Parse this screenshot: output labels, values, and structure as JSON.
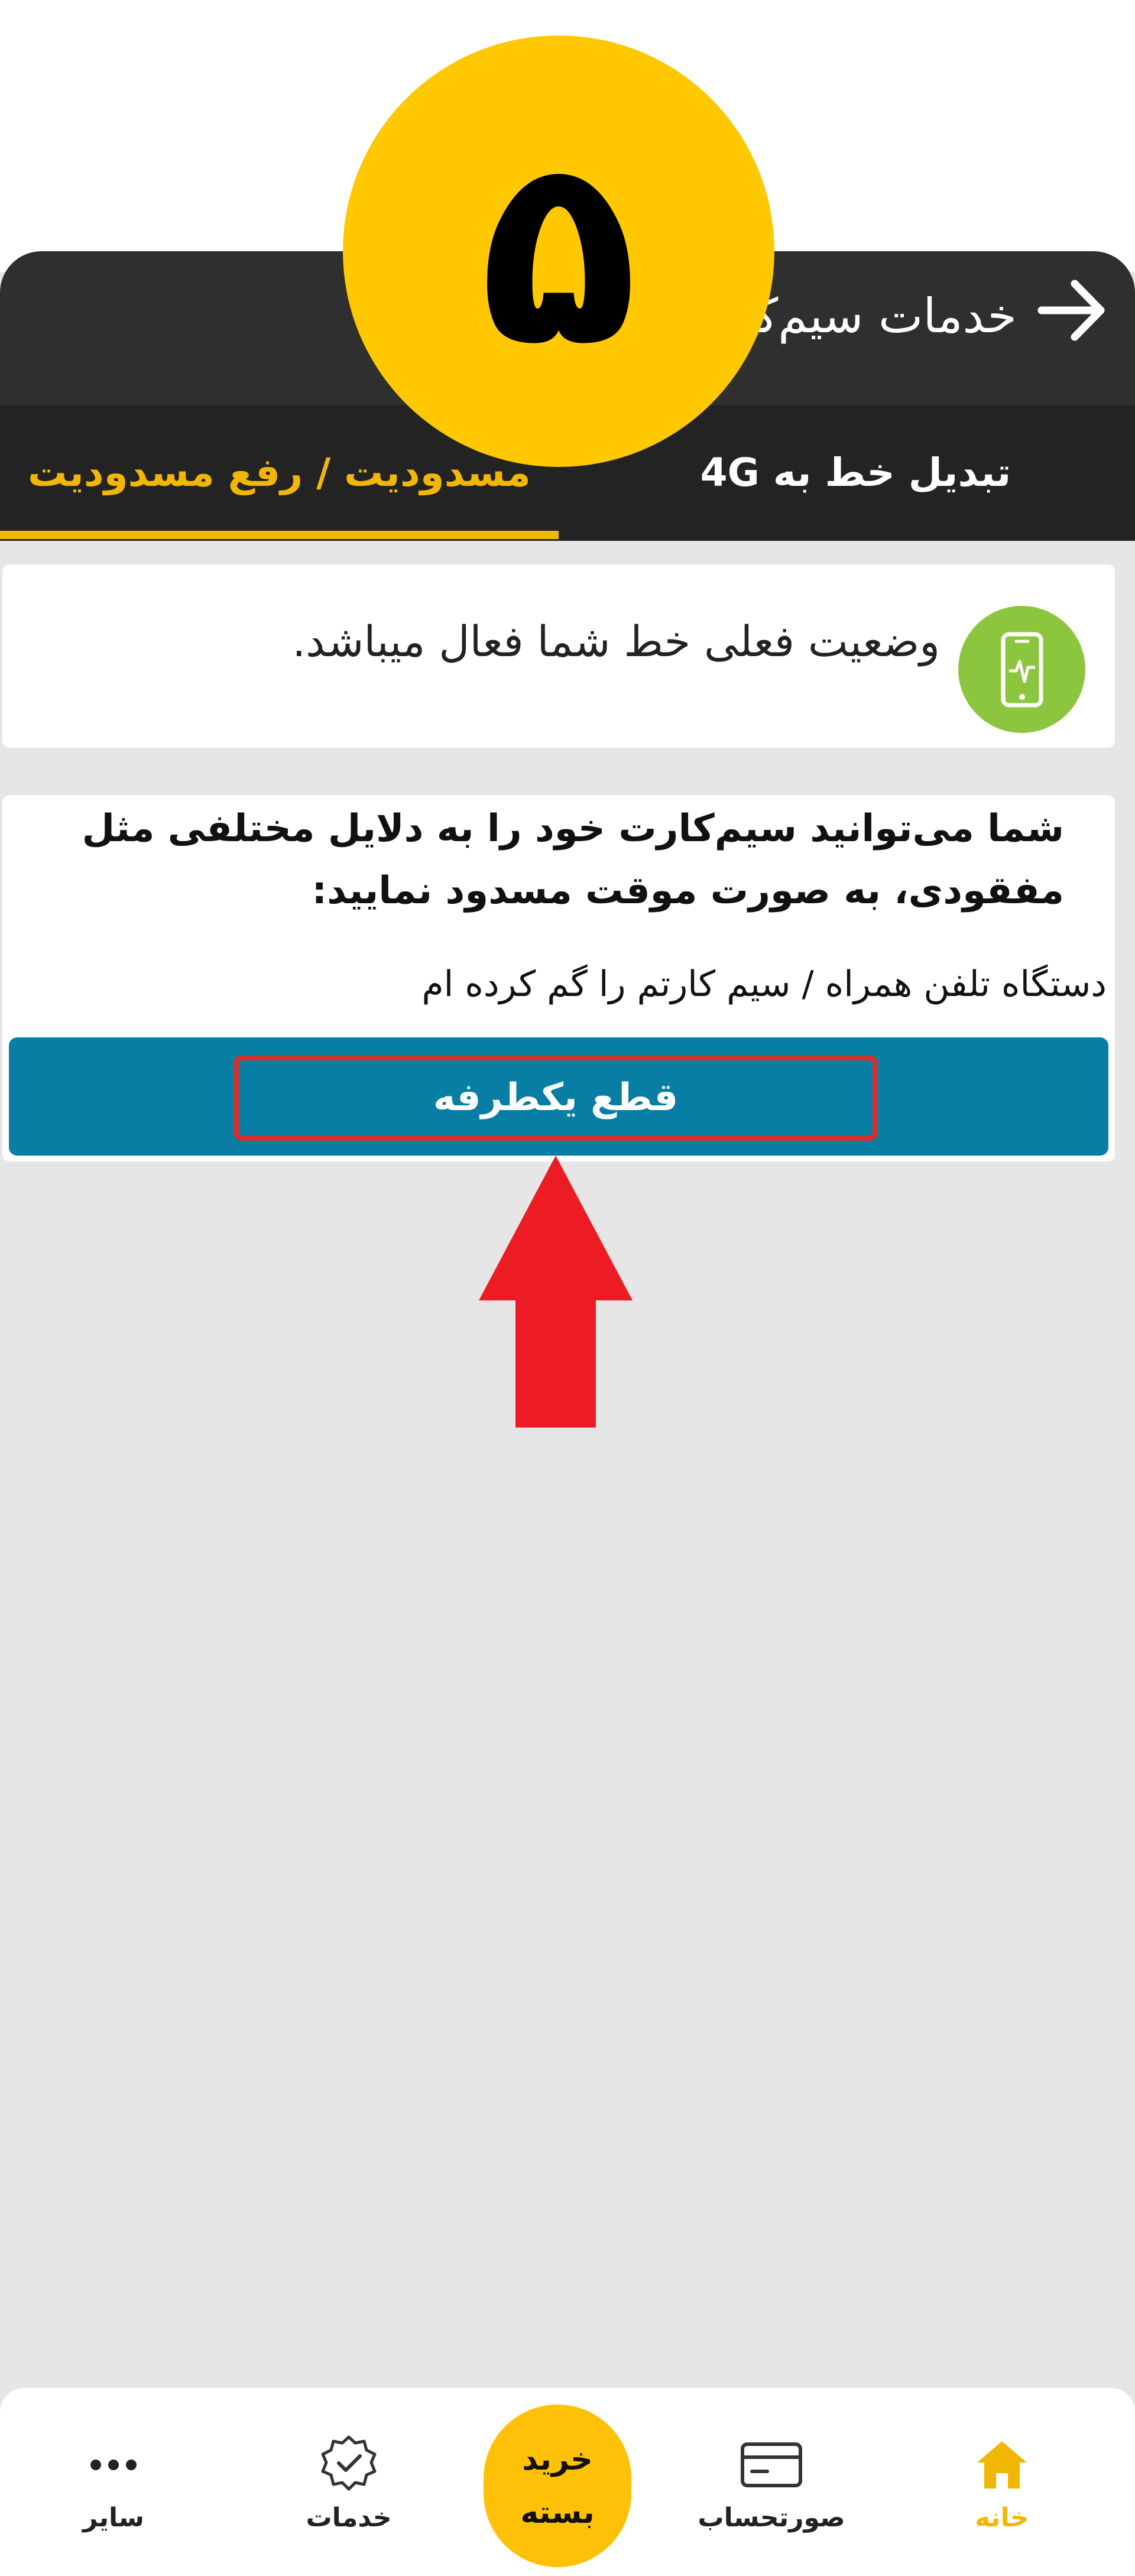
{
  "step": {
    "number": "۵"
  },
  "header": {
    "title": "خدمات سیم‌کارت",
    "back_icon": "arrow-right-icon"
  },
  "tabs": [
    {
      "label": "تبدیل خط به 4G",
      "active": false
    },
    {
      "label": "مسدودیت / رفع مسدودیت",
      "active": true
    }
  ],
  "status": {
    "icon": "phone-signal-icon",
    "text": "وضعیت فعلی خط شما فعال میباشد."
  },
  "block": {
    "description": "شما می‌توانید سیم‌کارت خود را به دلایل مختلفی مثل مفقودی، به صورت موقت مسدود نمایید:",
    "reason": "دستگاه تلفن همراه / سیم کارتم را گم کرده ام",
    "action_label": "قطع یکطرفه"
  },
  "nav": {
    "home": "خانه",
    "bill": "صورتحساب",
    "buy": "خرید بسته",
    "services": "خدمات",
    "other": "سایر"
  },
  "colors": {
    "accent": "#f2b705",
    "step_circle": "#ffc800",
    "action": "#087ea4",
    "status_icon": "#8cc63f",
    "highlight": "#d32f2f"
  }
}
